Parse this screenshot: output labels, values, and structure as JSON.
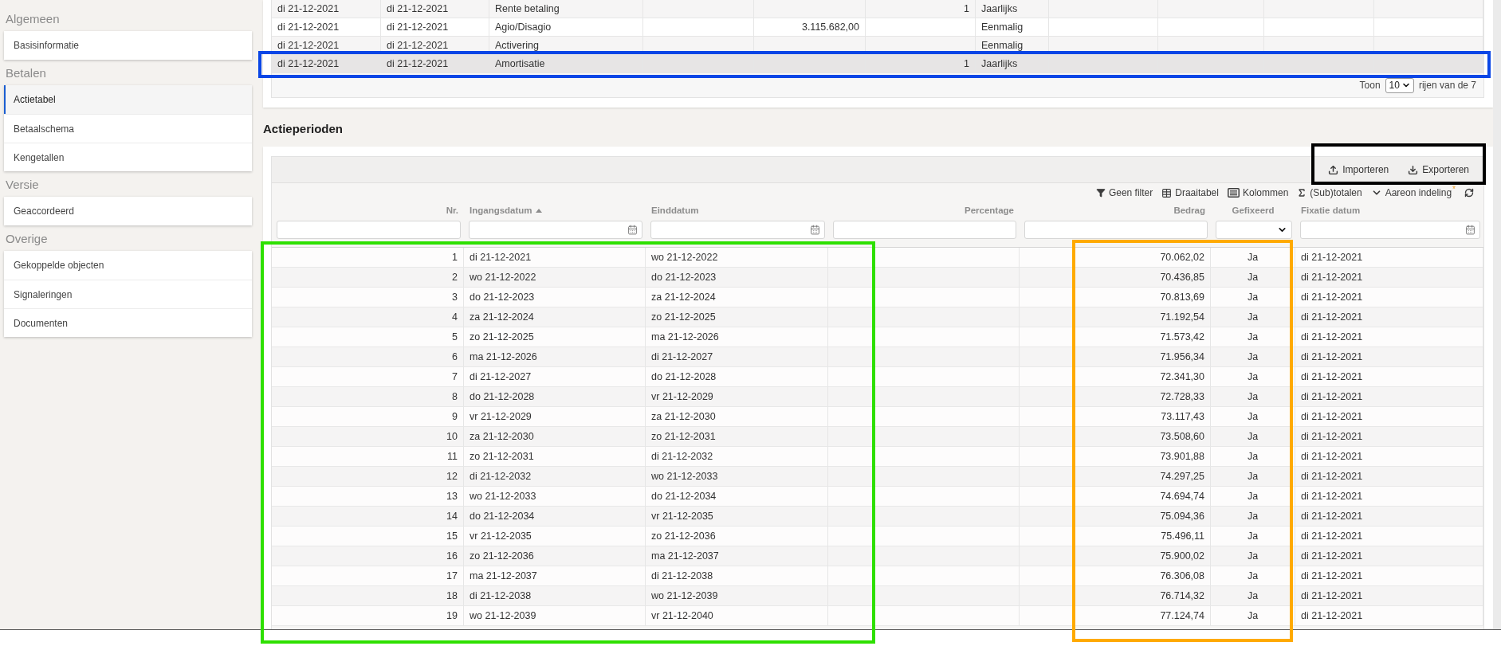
{
  "sidebar": {
    "sections": [
      {
        "title": "Algemeen",
        "items": [
          {
            "label": "Basisinformatie",
            "selected": false
          }
        ]
      },
      {
        "title": "Betalen",
        "items": [
          {
            "label": "Actietabel",
            "selected": true
          },
          {
            "label": "Betaalschema",
            "selected": false
          },
          {
            "label": "Kengetallen",
            "selected": false
          }
        ]
      },
      {
        "title": "Versie",
        "items": [
          {
            "label": "Geaccordeerd",
            "selected": false
          }
        ]
      },
      {
        "title": "Overige",
        "items": [
          {
            "label": "Gekoppelde objecten",
            "selected": false
          },
          {
            "label": "Signaleringen",
            "selected": false
          },
          {
            "label": "Documenten",
            "selected": false
          }
        ]
      }
    ]
  },
  "top_table": {
    "rows": [
      {
        "selected": false,
        "cells": {
          "column_1": "di 21-12-2021",
          "column_2": "di 21-12-2021",
          "column_3": "Rente betaling",
          "column_6": "1",
          "column_7": "Jaarlijks"
        }
      },
      {
        "selected": false,
        "cells": {
          "column_1": "di 21-12-2021",
          "column_2": "di 21-12-2021",
          "column_3": "Agio/Disagio",
          "column_5": "3.115.682,00",
          "column_7": "Eenmalig"
        }
      },
      {
        "selected": false,
        "cells": {
          "column_1": "di 21-12-2021",
          "column_2": "di 21-12-2021",
          "column_3": "Activering",
          "column_7": "Eenmalig"
        }
      },
      {
        "selected": true,
        "cells": {
          "column_1": "di 21-12-2021",
          "column_2": "di 21-12-2021",
          "column_3": "Amortisatie",
          "column_6": "1",
          "column_7": "Jaarlijks"
        }
      }
    ],
    "pagination": {
      "prefix": "Toon",
      "page_size": "10",
      "suffix": "rijen van de 7"
    }
  },
  "section_title": "Actieperioden",
  "periods": {
    "actions": [
      {
        "kind": "import",
        "label": "Importeren"
      },
      {
        "kind": "export",
        "label": "Exporteren"
      }
    ],
    "tools": [
      {
        "kind": "filter",
        "label": "Geen filter"
      },
      {
        "kind": "pivot",
        "label": "Draaitabel"
      },
      {
        "kind": "columns",
        "label": "Kolommen"
      },
      {
        "kind": "totals",
        "label": "(Sub)totalen"
      },
      {
        "kind": "layout",
        "label": "Aareon indeling",
        "marker": "*"
      },
      {
        "kind": "refresh"
      }
    ],
    "columns": [
      {
        "label": "Nr.",
        "sorted": false
      },
      {
        "label": "Ingangsdatum",
        "sorted": true
      },
      {
        "label": "Einddatum",
        "sorted": false
      },
      {
        "label": "Percentage",
        "sorted": false
      },
      {
        "label": "Bedrag",
        "sorted": false
      },
      {
        "label": "Gefixeerd",
        "sorted": false
      },
      {
        "label": "Fixatie datum",
        "sorted": false
      }
    ],
    "filters": [
      {
        "kind": "text"
      },
      {
        "kind": "date"
      },
      {
        "kind": "date"
      },
      {
        "kind": "text"
      },
      {
        "kind": "text"
      },
      {
        "kind": "select"
      },
      {
        "kind": "date"
      }
    ],
    "rows": [
      {
        "nr": "1",
        "start": "di 21-12-2021",
        "end": "wo 21-12-2022",
        "amount": "70.062,02",
        "fixed": "Ja",
        "fixed_date": "di 21-12-2021"
      },
      {
        "nr": "2",
        "start": "wo 21-12-2022",
        "end": "do 21-12-2023",
        "amount": "70.436,85",
        "fixed": "Ja",
        "fixed_date": "di 21-12-2021"
      },
      {
        "nr": "3",
        "start": "do 21-12-2023",
        "end": "za 21-12-2024",
        "amount": "70.813,69",
        "fixed": "Ja",
        "fixed_date": "di 21-12-2021"
      },
      {
        "nr": "4",
        "start": "za 21-12-2024",
        "end": "zo 21-12-2025",
        "amount": "71.192,54",
        "fixed": "Ja",
        "fixed_date": "di 21-12-2021"
      },
      {
        "nr": "5",
        "start": "zo 21-12-2025",
        "end": "ma 21-12-2026",
        "amount": "71.573,42",
        "fixed": "Ja",
        "fixed_date": "di 21-12-2021"
      },
      {
        "nr": "6",
        "start": "ma 21-12-2026",
        "end": "di 21-12-2027",
        "amount": "71.956,34",
        "fixed": "Ja",
        "fixed_date": "di 21-12-2021"
      },
      {
        "nr": "7",
        "start": "di 21-12-2027",
        "end": "do 21-12-2028",
        "amount": "72.341,30",
        "fixed": "Ja",
        "fixed_date": "di 21-12-2021"
      },
      {
        "nr": "8",
        "start": "do 21-12-2028",
        "end": "vr 21-12-2029",
        "amount": "72.728,33",
        "fixed": "Ja",
        "fixed_date": "di 21-12-2021"
      },
      {
        "nr": "9",
        "start": "vr 21-12-2029",
        "end": "za 21-12-2030",
        "amount": "73.117,43",
        "fixed": "Ja",
        "fixed_date": "di 21-12-2021"
      },
      {
        "nr": "10",
        "start": "za 21-12-2030",
        "end": "zo 21-12-2031",
        "amount": "73.508,60",
        "fixed": "Ja",
        "fixed_date": "di 21-12-2021"
      },
      {
        "nr": "11",
        "start": "zo 21-12-2031",
        "end": "di 21-12-2032",
        "amount": "73.901,88",
        "fixed": "Ja",
        "fixed_date": "di 21-12-2021"
      },
      {
        "nr": "12",
        "start": "di 21-12-2032",
        "end": "wo 21-12-2033",
        "amount": "74.297,25",
        "fixed": "Ja",
        "fixed_date": "di 21-12-2021"
      },
      {
        "nr": "13",
        "start": "wo 21-12-2033",
        "end": "do 21-12-2034",
        "amount": "74.694,74",
        "fixed": "Ja",
        "fixed_date": "di 21-12-2021"
      },
      {
        "nr": "14",
        "start": "do 21-12-2034",
        "end": "vr 21-12-2035",
        "amount": "75.094,36",
        "fixed": "Ja",
        "fixed_date": "di 21-12-2021"
      },
      {
        "nr": "15",
        "start": "vr 21-12-2035",
        "end": "zo 21-12-2036",
        "amount": "75.496,11",
        "fixed": "Ja",
        "fixed_date": "di 21-12-2021"
      },
      {
        "nr": "16",
        "start": "zo 21-12-2036",
        "end": "ma 21-12-2037",
        "amount": "75.900,02",
        "fixed": "Ja",
        "fixed_date": "di 21-12-2021"
      },
      {
        "nr": "17",
        "start": "ma 21-12-2037",
        "end": "di 21-12-2038",
        "amount": "76.306,08",
        "fixed": "Ja",
        "fixed_date": "di 21-12-2021"
      },
      {
        "nr": "18",
        "start": "di 21-12-2038",
        "end": "wo 21-12-2039",
        "amount": "76.714,32",
        "fixed": "Ja",
        "fixed_date": "di 21-12-2021"
      },
      {
        "nr": "19",
        "start": "wo 21-12-2039",
        "end": "vr 21-12-2040",
        "amount": "77.124,74",
        "fixed": "Ja",
        "fixed_date": "di 21-12-2021"
      }
    ]
  },
  "annotation_frames": [
    {
      "color": "#0a46e6"
    },
    {
      "color": "#000000"
    },
    {
      "color": "#2ee000"
    },
    {
      "color": "#ffaa00"
    }
  ]
}
